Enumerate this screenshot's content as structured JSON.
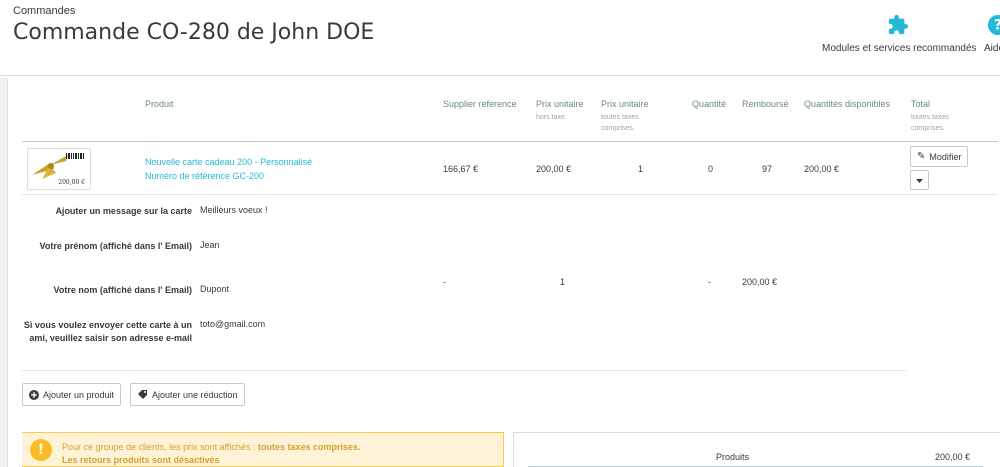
{
  "header": {
    "breadcrumb": "Commandes",
    "title": "Commande CO-280 de John DOE",
    "modules_label": "Modules et services recommandés",
    "help_label": "Aide"
  },
  "table": {
    "columns": {
      "product": "Produit",
      "supplier_ref": "Supplier reference",
      "unit_price": "Prix unitaire",
      "unit_price_sub": "hors taxe.",
      "unit_price_ttc": "Prix unitaire",
      "unit_price_ttc_sub1": "toutes taxes",
      "unit_price_ttc_sub2": "comprises.",
      "quantity": "Quantité",
      "refunded": "Remboursé",
      "available": "Quantités disponibles",
      "total": "Total",
      "total_sub1": "toutes taxes",
      "total_sub2": "comprises."
    },
    "product_row": {
      "thumb_price": "200,00 €",
      "name": "Nouvelle carte cadeau 200 - Personnalisé",
      "reference": "Numéro de référence GC-200",
      "supplier_ref": "166,67 €",
      "unit_price": "200,00 €",
      "unit_price_ttc": "1",
      "quantity": "0",
      "refunded": "97",
      "available": "200,00 €",
      "modify_label": "Modifier"
    },
    "custom_fields": [
      {
        "label": "Ajouter un message sur la carte",
        "value": "Meilleurs voeux !"
      },
      {
        "label": "Votre prénom (affiché dans l' Email)",
        "value": "Jean"
      },
      {
        "label": "Votre nom (affiché dans l' Email)",
        "value": "Dupont"
      },
      {
        "label": "Si vous voulez envoyer cette carte à un ami, veuillez saisir son adresse e-mail",
        "value": "toto@gmail.com"
      }
    ],
    "custom_row": {
      "supplier_ref": "-",
      "unit_price_ttc": "1",
      "quantity": "-",
      "refunded": "200,00 €"
    }
  },
  "actions": {
    "add_product": "Ajouter un produit",
    "add_discount": "Ajouter une réduction"
  },
  "alert": {
    "line1_prefix": "Pour ce groupe de clients, les prix sont affichés : ",
    "line1_bold": "toutes taxes comprises.",
    "line2": "Les retours produits sont désactivés"
  },
  "summary": {
    "products_label": "Produits",
    "products_value": "200,00 €"
  },
  "colors": {
    "link": "#25b9d7",
    "alert_bg": "#fff3d7",
    "alert_icon": "#fbbb22"
  }
}
